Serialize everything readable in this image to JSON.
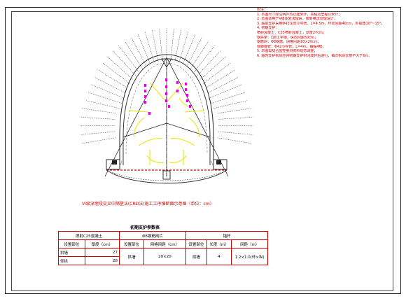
{
  "notes": {
    "title": "附注：",
    "lines": [
      "1. 本图尺寸除注明外均以厘米计，高程及里程以米计；",
      "2. 本图适用于V级围岩浅埋段，按新奥法原理设计；",
      "3. 超前支护采用Φ42注浆小导管，L=4.5m，环向间距40cm，外插角10°~15°；",
      "4. 初期支护：",
      "   喷射混凝土：C25喷射混凝土，厚度27cm；",
      "   钢拱架：I18工字钢，纵向间距50cm；",
      "   钢筋网：Φ8钢筋，网格间距20×20cm；",
      "   锁脚锚管：Φ42小导管，L=4m，每榀4根；",
      "5. 本图需结合监控量测资料动态调整；",
      "6. 临时支护拆除应待初期支护封闭成环后进行，每次拆除长度不大于6m。"
    ]
  },
  "caption": "VI级深埋段交叉中隔壁法(CRD法)施工工序横断面示意图（单位：cm）",
  "table": {
    "title": "初期支护参数表",
    "group_headers": [
      "喷射C25混凝土",
      "Φ8钢筋网片",
      "锚杆"
    ],
    "sub_headers": [
      "设置部位",
      "厚度（cm）",
      "设置部位",
      "网格间距（cm）",
      "设置部位",
      "长度（m）",
      "间距（m）"
    ],
    "rows": [
      [
        "拱墙",
        "27",
        "拱墙",
        "20×20",
        "拱墙",
        "4",
        "1.2×1.0(环×纵)"
      ],
      [
        "仰拱",
        "28",
        "",
        "",
        "",
        "",
        ""
      ]
    ]
  },
  "colors": {
    "outline": "#000000",
    "structure": "#222222",
    "rebar": "#d40000",
    "sequence_arrows": "#e6e600",
    "anchors": "#e000e0",
    "dashed": "#555555"
  }
}
